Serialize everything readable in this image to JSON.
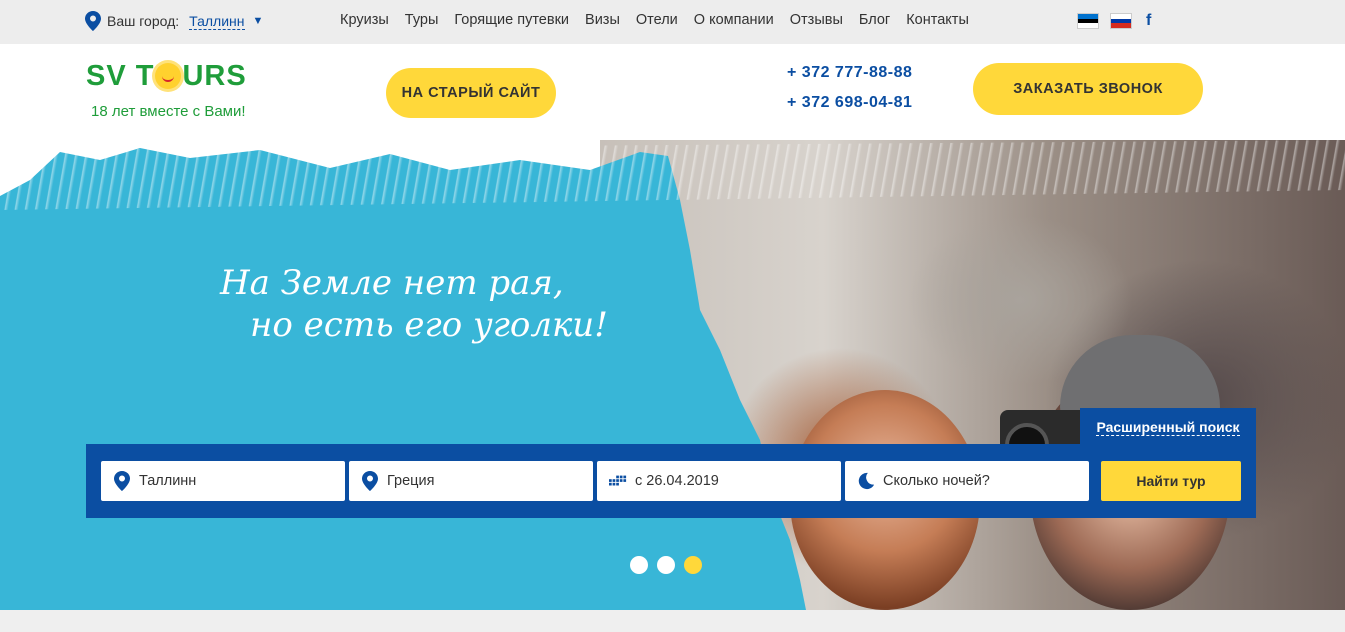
{
  "topbar": {
    "city_label": "Ваш город:",
    "city_value": "Таллинн",
    "nav": [
      "Круизы",
      "Туры",
      "Горящие путевки",
      "Визы",
      "Отели",
      "О компании",
      "Отзывы",
      "Блог",
      "Контакты"
    ],
    "facebook": "f"
  },
  "header": {
    "logo_left": "SV T",
    "logo_right": "URS",
    "logo_sub": "18 лет вместе с Вами!",
    "old_site_button": "НА СТАРЫЙ САЙТ",
    "phone1": "+ 372 777-88-88",
    "phone2": "+ 372 698-04-81",
    "callback_button": "ЗАКАЗАТЬ ЗВОНОК"
  },
  "hero": {
    "tagline_line1": "На Земле нет рая,",
    "tagline_line2": "но есть его уголки!"
  },
  "search": {
    "advanced_link": "Расширенный поиск",
    "from_city": "Таллинн",
    "destination": "Греция",
    "date": "с 26.04.2019",
    "nights_placeholder": "Сколько ночей?",
    "submit": "Найти тур"
  },
  "slider": {
    "count": 3,
    "active_index": 2
  },
  "colors": {
    "brand_blue": "#0b4ea2",
    "accent_yellow": "#ffd83a",
    "hero_cyan": "#38b6d7",
    "logo_green": "#1f9d3a"
  }
}
